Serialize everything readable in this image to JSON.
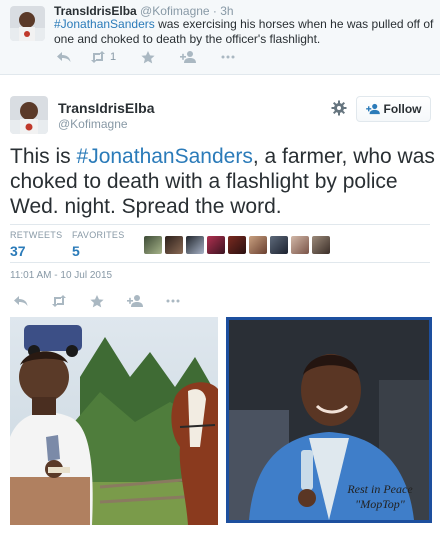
{
  "reply": {
    "name": "TransIdrisElba",
    "handle_time": "@Kofimagne · 3h",
    "hashtag": "#JonathanSanders",
    "text": " was exercising his horses when he was pulled off of one and choked to death by the officer's flashlight.",
    "retweet_count": "1"
  },
  "tweet": {
    "name": "TransIdrisElba",
    "handle": "@Kofimagne",
    "follow_label": "Follow",
    "text_before": "This is ",
    "hashtag": "#JonathanSanders",
    "text_after": ", a farmer, who was choked to death with a flashlight by police Wed. night. Spread the word.",
    "retweets_label": "RETWEETS",
    "retweets_count": "37",
    "favorites_label": "FAVORITES",
    "favorites_count": "5",
    "timestamp": "11:01 AM - 10 Jul 2015"
  },
  "photo_right": {
    "caption_line1": "Rest in Peace",
    "caption_line2": "\"MopTop\""
  },
  "colors": {
    "link": "#2b7bb9",
    "muted": "#8899a6",
    "text": "#292f33",
    "photo_border": "#1d4f9e"
  },
  "icons": [
    "reply-icon",
    "retweet-icon",
    "favorite-icon",
    "follow-user-icon",
    "more-icon",
    "gear-icon"
  ]
}
